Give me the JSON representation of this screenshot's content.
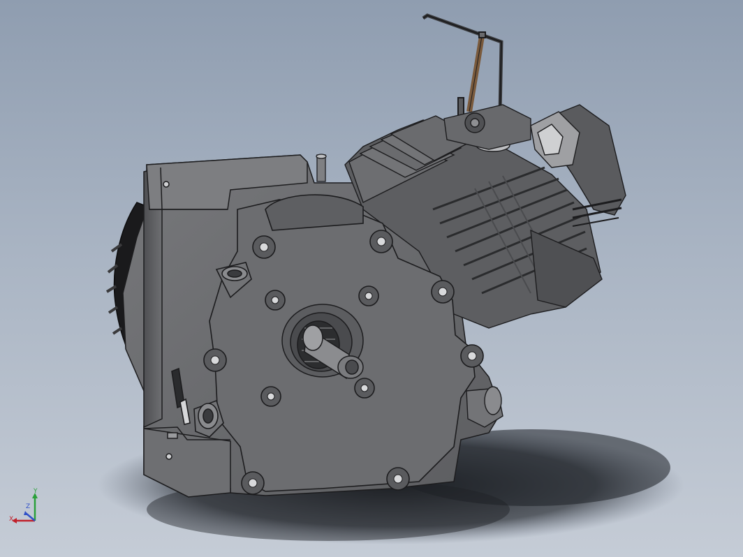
{
  "viewport": {
    "background_top": "#8f9db0",
    "background_bottom": "#c5ccd6"
  },
  "model": {
    "icon": "engine-assembly",
    "body_color": "#6a6b6e",
    "edge_color": "#1c1c1e",
    "accent_color": "#7a5a3c"
  },
  "triad": {
    "x_label": "X",
    "y_label": "Y",
    "z_label": "Z",
    "x_color": "#c0202a",
    "y_color": "#2aa03a",
    "z_color": "#3050c8"
  }
}
